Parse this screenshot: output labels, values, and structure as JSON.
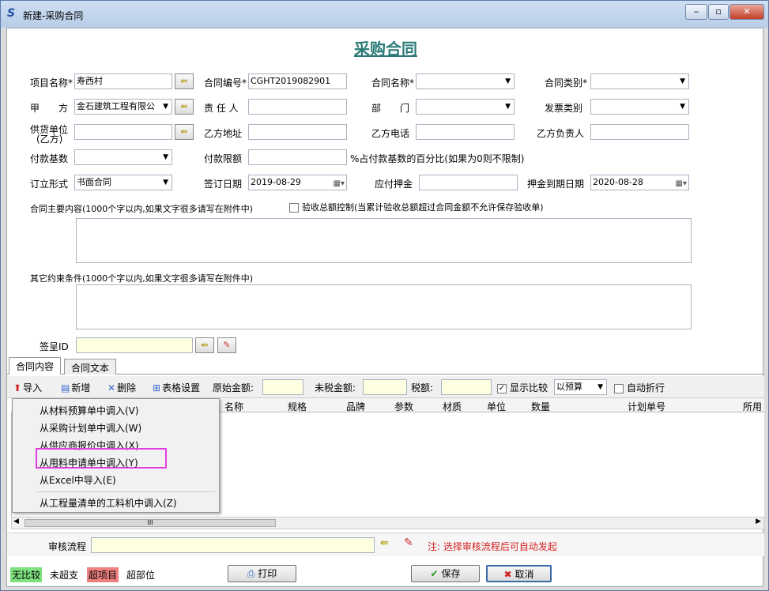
{
  "window": {
    "title": "新建-采购合同",
    "app_icon": "S",
    "buttons": {
      "minimize": "‒",
      "maximize": "▫",
      "close": "✕"
    }
  },
  "form": {
    "title": "采购合同",
    "project_name": {
      "label": "项目名称*",
      "value": "寿西村"
    },
    "contract_no": {
      "label": "合同编号*",
      "value": "CGHT2019082901"
    },
    "contract_name": {
      "label": "合同名称*",
      "value": ""
    },
    "contract_type": {
      "label": "合同类别*",
      "value": ""
    },
    "party_a": {
      "label": "甲　　方",
      "value": "金石建筑工程有限公"
    },
    "person_in_charge": {
      "label": "责 任 人",
      "value": ""
    },
    "department": {
      "label": "部　　门",
      "value": ""
    },
    "invoice_type": {
      "label": "发票类别",
      "value": ""
    },
    "supplier": {
      "label": "供货单位",
      "label2": "(乙方)",
      "value": ""
    },
    "party_b_address": {
      "label": "乙方地址",
      "value": ""
    },
    "party_b_phone": {
      "label": "乙方电话",
      "value": ""
    },
    "party_b_person": {
      "label": "乙方负责人",
      "value": ""
    },
    "payment_base": {
      "label": "付款基数",
      "value": ""
    },
    "payment_limit": {
      "label": "付款限额",
      "value": "",
      "note": "%占付款基数的百分比(如果为0则不限制)"
    },
    "contract_form": {
      "label": "订立形式",
      "value": "书面合同"
    },
    "sign_date": {
      "label": "签订日期",
      "value": "2019-08-29"
    },
    "deposit": {
      "label": "应付押金",
      "value": ""
    },
    "deposit_expiry": {
      "label": "押金到期日期",
      "value": "2020-08-28"
    },
    "main_content_label": "合同主要内容(1000个字以内,如果文字很多请写在附件中)",
    "acceptance_control": "验收总额控制(当累计验收总额超过合同金额不允许保存验收单)",
    "other_terms_label": "其它约束条件(1000个字以内,如果文字很多请写在附件中)",
    "sign_id": {
      "label": "签呈ID",
      "value": ""
    }
  },
  "tabs": [
    {
      "label": "合同内容"
    },
    {
      "label": "合同文本"
    }
  ],
  "toolbar": {
    "import": "导入",
    "add": "新增",
    "delete": "删除",
    "table_settings": "表格设置",
    "original_amount": "原始金额:",
    "untaxed_amount": "未税金额:",
    "tax": "税额:",
    "show_compare": "显示比较",
    "compare_select": "以预算",
    "auto_wrap": "自动折行"
  },
  "grid": {
    "columns": [
      "名称",
      "规格",
      "品牌",
      "参数",
      "材质",
      "单位",
      "数量",
      "计划单号",
      "所用"
    ]
  },
  "import_menu": {
    "items": [
      "从材料预算单中调入(V)",
      "从采购计划单中调入(W)",
      "从供应商报价中调入(X)",
      "从用料申请单中调入(Y)",
      "从Excel中导入(E)",
      "从工程量清单的工料机中调入(Z)"
    ]
  },
  "approval": {
    "label": "审核流程",
    "value": "",
    "note": "注: 选择审核流程后可自动发起"
  },
  "legend": [
    {
      "label": "无比较",
      "color": "#7ee07e"
    },
    {
      "label": "未超支",
      "color": "#ffffff"
    },
    {
      "label": "超项目",
      "color": "#f08080"
    },
    {
      "label": "超部位",
      "color": "#ffffff"
    }
  ],
  "buttons": {
    "print": "打印",
    "save": "保存",
    "cancel": "取消"
  },
  "scroll_mark": "III"
}
